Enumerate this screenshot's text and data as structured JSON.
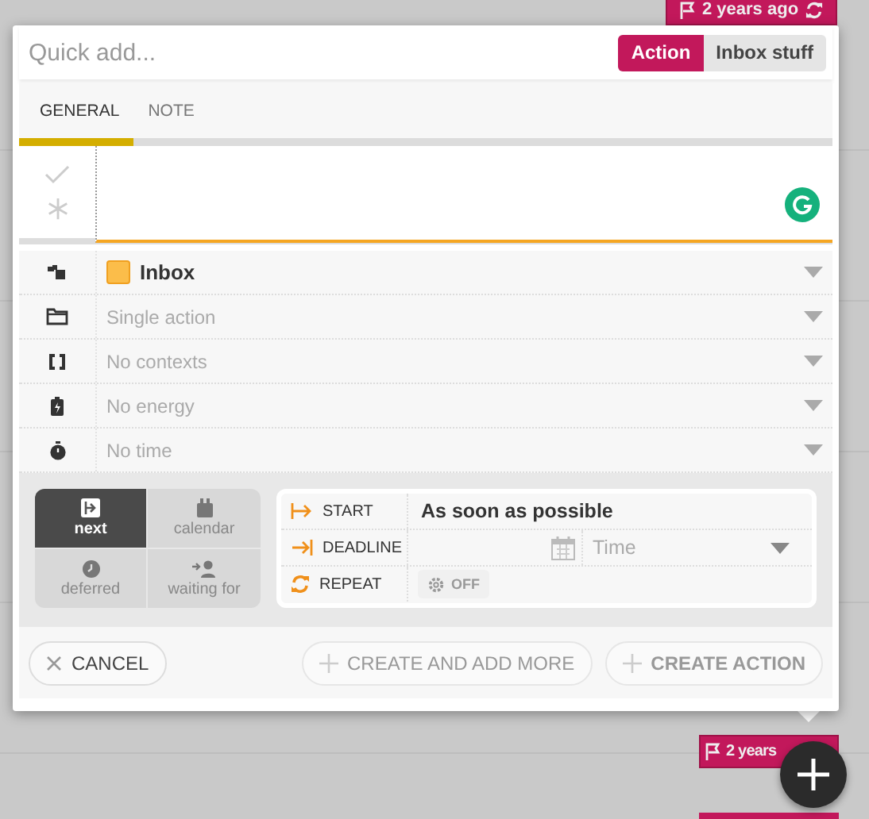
{
  "background_badges": [
    {
      "label": "2 years ago",
      "kind": "full"
    },
    {
      "label": "2 years",
      "kind": "covered"
    }
  ],
  "quick_add": {
    "placeholder": "Quick add..."
  },
  "type_toggle": [
    {
      "label": "Action",
      "selected": true
    },
    {
      "label": "Inbox stuff",
      "selected": false
    }
  ],
  "tabs": [
    {
      "label": "GENERAL",
      "selected": true
    },
    {
      "label": "NOTE",
      "selected": false
    }
  ],
  "title_field": {
    "done": false,
    "starred": false
  },
  "fields": [
    {
      "kind": "project",
      "value": "Inbox",
      "color": "#fbbd4a"
    },
    {
      "kind": "folder",
      "placeholder": "Single action"
    },
    {
      "kind": "contexts",
      "placeholder": "No contexts"
    },
    {
      "kind": "energy",
      "placeholder": "No energy"
    },
    {
      "kind": "time",
      "placeholder": "No time"
    }
  ],
  "states": [
    {
      "kind": "next",
      "label": "next",
      "selected": true
    },
    {
      "kind": "calendar",
      "label": "calendar",
      "selected": false
    },
    {
      "kind": "deferred",
      "label": "deferred",
      "selected": false
    },
    {
      "kind": "waiting",
      "label": "waiting for",
      "selected": false
    }
  ],
  "dates": [
    {
      "kind": "start",
      "label": "START",
      "value": "As soon as possible"
    },
    {
      "kind": "deadline",
      "label": "DEADLINE",
      "time_placeholder": "Time"
    },
    {
      "kind": "repeat",
      "label": "REPEAT",
      "toggle": "OFF",
      "on": false
    }
  ],
  "footer_buttons": [
    {
      "kind": "cancel",
      "label": "CANCEL",
      "disabled": false
    },
    {
      "kind": "add_more",
      "label": "CREATE AND ADD MORE",
      "disabled": true
    },
    {
      "kind": "create",
      "label": "CREATE ACTION",
      "disabled": true
    }
  ]
}
